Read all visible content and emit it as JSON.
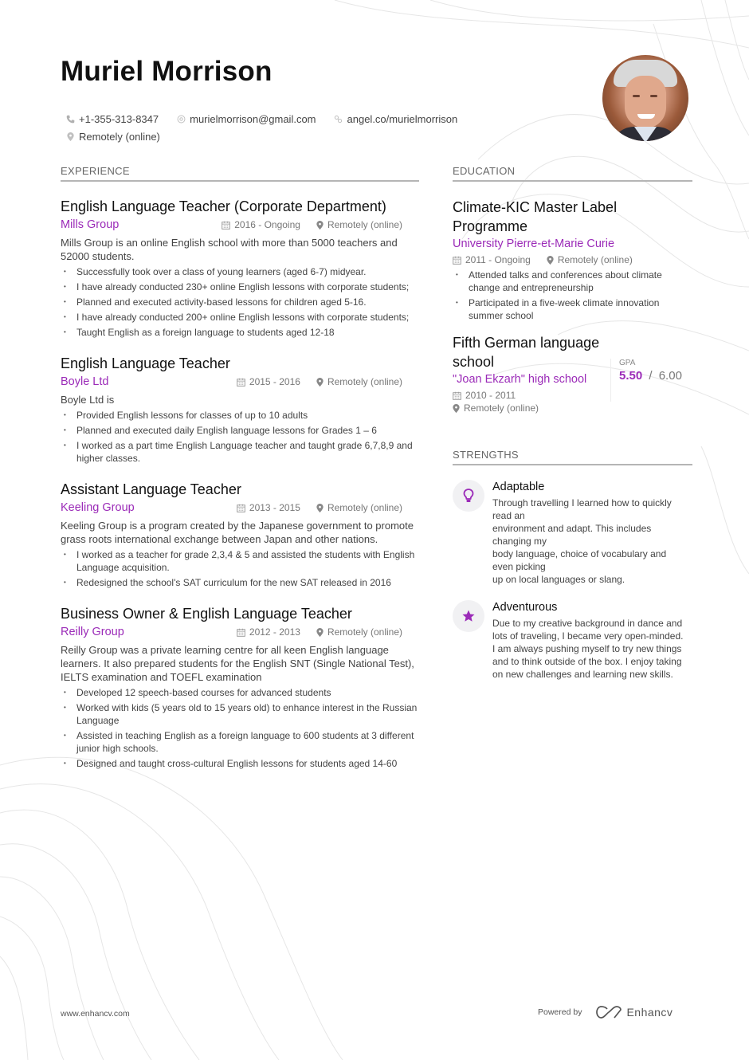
{
  "header": {
    "name": "Muriel Morrison",
    "contacts": {
      "phone": "+1-355-313-8347",
      "email": "murielmorrison@gmail.com",
      "website": "angel.co/murielmorrison",
      "location": "Remotely (online)"
    }
  },
  "colors": {
    "accent": "#9b2bb8",
    "text": "#111111",
    "muted": "#777777"
  },
  "experience": {
    "title": "EXPERIENCE",
    "jobs": [
      {
        "title": "English Language Teacher (Corporate Department)",
        "company": "Mills Group",
        "dates": "2016 - Ongoing",
        "location": "Remotely (online)",
        "description": "Mills Group is an online English school with more than 5000 teachers and 52000 students.",
        "bullets": [
          "Successfully took over a class of young learners (aged 6-7) midyear.",
          "I have already conducted 230+ online English lessons with corporate students;",
          "Planned and executed activity-based lessons for children aged 5-16.",
          "I have already conducted 200+ online English lessons with corporate students;",
          "Taught English as a foreign language to students aged 12-18"
        ]
      },
      {
        "title": "English Language Teacher",
        "company": "Boyle Ltd",
        "dates": "2015 - 2016",
        "location": "Remotely (online)",
        "description": "Boyle Ltd is",
        "bullets": [
          "Provided English lessons for classes of up to 10 adults",
          "Planned and executed daily English language lessons for Grades 1 – 6",
          "I worked as a part time English Language teacher and taught grade 6,7,8,9 and higher classes."
        ]
      },
      {
        "title": "Assistant Language Teacher",
        "company": "Keeling Group",
        "dates": "2013 - 2015",
        "location": "Remotely (online)",
        "description": "Keeling Group is a program created by the Japanese government to promote grass roots international exchange between Japan and other nations.",
        "bullets": [
          "I worked as a teacher for grade 2,3,4 & 5 and assisted the students with English Language acquisition.",
          "Redesigned the school's SAT curriculum for the new SAT released in 2016"
        ]
      },
      {
        "title": "Business Owner & English Language Teacher",
        "company": "Reilly Group",
        "dates": "2012 - 2013",
        "location": "Remotely (online)",
        "description": "Reilly Group was a private learning centre for all keen English language learners. It also prepared students for the English SNT (Single National Test), IELTS examination and TOEFL examination",
        "bullets": [
          "Developed 12 speech-based courses for advanced students",
          "Worked with kids (5 years old to 15 years old) to enhance interest in the Russian Language",
          "Assisted in teaching English as a foreign language to 600 students at 3 different junior high schools.",
          "Designed and taught cross-cultural English lessons for students aged 14-60"
        ]
      }
    ]
  },
  "education": {
    "title": "EDUCATION",
    "items": [
      {
        "degree": "Climate-KIC Master Label Programme",
        "school": "University Pierre-et-Marie Curie",
        "dates": "2011 - Ongoing",
        "location": "Remotely (online)",
        "bullets": [
          "Attended talks and conferences about climate change and entrepreneurship",
          "Participated in a five-week climate innovation summer school"
        ]
      },
      {
        "degree": "Fifth German language school",
        "school": "\"Joan Ekzarh\" high school",
        "dates": "2010 - 2011",
        "location": "Remotely (online)",
        "gpa_label": "GPA",
        "gpa": "5.50",
        "gpa_separator": "/",
        "gpa_max": "6.00"
      }
    ]
  },
  "strengths": {
    "title": "STRENGTHS",
    "items": [
      {
        "icon": "lightbulb-icon",
        "title": "Adaptable",
        "lines": [
          "Through travelling I learned how to quickly read an",
          "environment and adapt. This includes changing my",
          "body language, choice of vocabulary and even picking",
          "up on local languages or slang."
        ]
      },
      {
        "icon": "star-icon",
        "title": "Adventurous",
        "lines": [
          "Due to my creative background in dance and lots of traveling, I became very open-minded. I am always pushing myself to try new things and to think outside of the box. I enjoy taking on new challenges and learning new skills."
        ]
      }
    ]
  },
  "footer": {
    "website": "www.enhancv.com",
    "powered_by": "Powered by",
    "brand": "Enhancv"
  }
}
